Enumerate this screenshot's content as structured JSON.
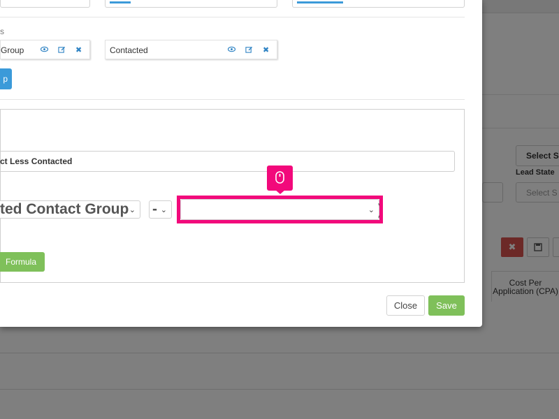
{
  "background": {
    "select_state_top": "Select S",
    "lead_state_label": "Lead State",
    "select_state_bottom": "Select S",
    "delete_icon": "close-icon",
    "save_icon": "floppy-icon",
    "column_header": "Cost Per Application (CPA)"
  },
  "modal": {
    "section_label_fragment": "s",
    "groups": [
      {
        "label": "Group"
      },
      {
        "label": "Contacted"
      }
    ],
    "add_button_fragment": "p",
    "formula": {
      "name_value": "ct Less Contacted",
      "left_select_value": "ted Contact Group",
      "operator_value": "-",
      "right_select_value": "",
      "add_formula_label": "Formula"
    },
    "close_label": "Close",
    "save_label": "Save"
  },
  "colors": {
    "accent_blue": "#3b9ad9",
    "highlight_pink": "#f2097b",
    "green": "#7fc05a",
    "danger_red": "#d9534f"
  }
}
